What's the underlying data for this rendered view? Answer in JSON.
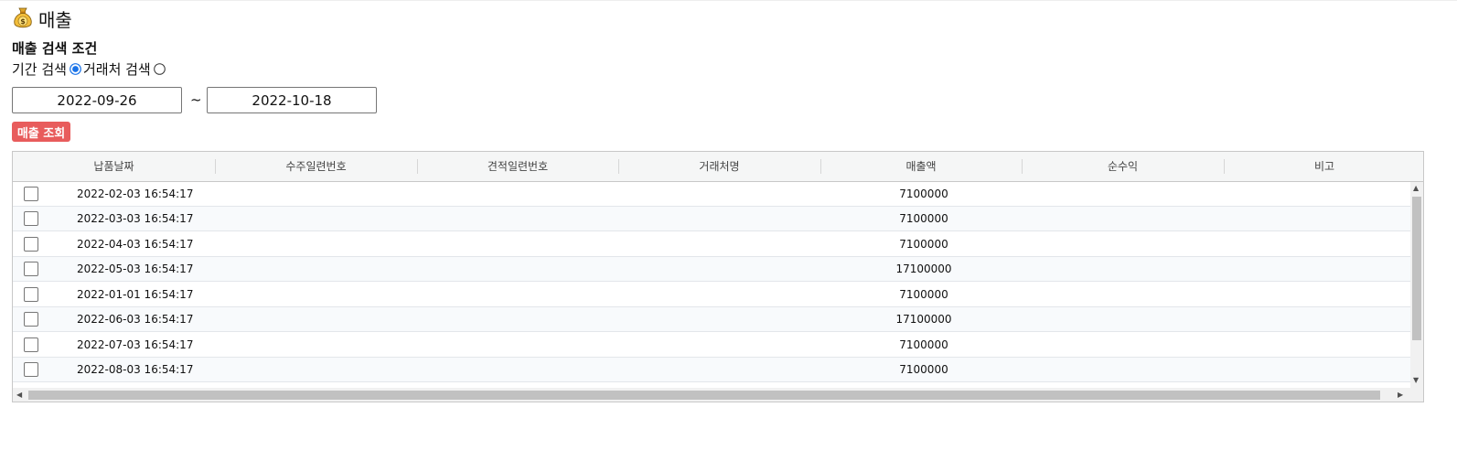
{
  "page": {
    "title": "매출",
    "title_icon": "money-bag-icon"
  },
  "search": {
    "section_title": "매출 검색 조건",
    "period_label": "기간 검색",
    "client_label": "거래처 검색",
    "selected_mode": "period",
    "start_date": "2022-09-26",
    "tilde": "~",
    "end_date": "2022-10-18",
    "button_label": "매출 조회",
    "button_color": "#e85c5c"
  },
  "table": {
    "columns": [
      "납품날짜",
      "수주일련번호",
      "견적일련번호",
      "거래처명",
      "매출액",
      "순수익",
      "비고"
    ],
    "rows": [
      {
        "date": "2022-02-03 16:54:17",
        "amount": "7100000"
      },
      {
        "date": "2022-03-03 16:54:17",
        "amount": "7100000"
      },
      {
        "date": "2022-04-03 16:54:17",
        "amount": "7100000"
      },
      {
        "date": "2022-05-03 16:54:17",
        "amount": "17100000"
      },
      {
        "date": "2022-01-01 16:54:17",
        "amount": "7100000"
      },
      {
        "date": "2022-06-03 16:54:17",
        "amount": "17100000"
      },
      {
        "date": "2022-07-03 16:54:17",
        "amount": "7100000"
      },
      {
        "date": "2022-08-03 16:54:17",
        "amount": "7100000"
      }
    ]
  }
}
